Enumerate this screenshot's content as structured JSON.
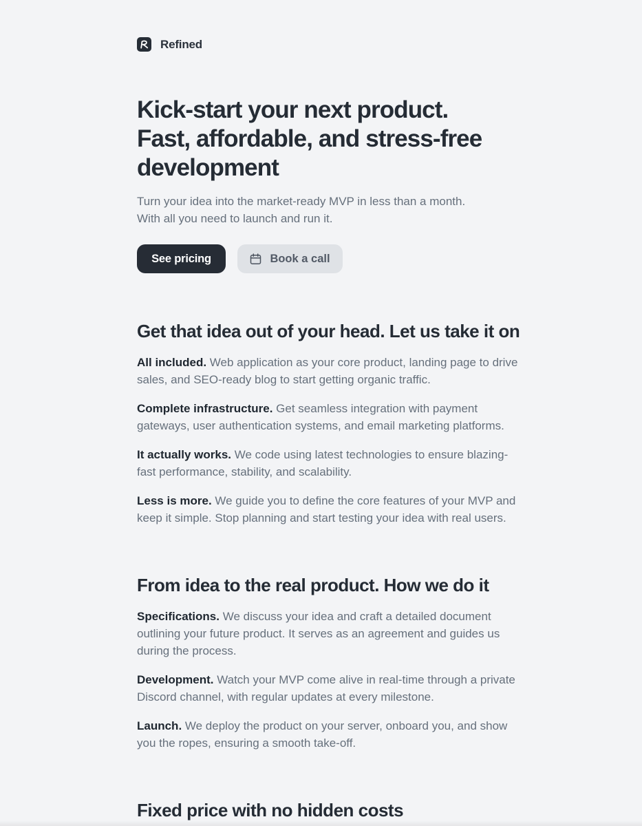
{
  "brand": {
    "name": "Refined",
    "logo_icon": "script-r-logo-icon"
  },
  "hero": {
    "title_lines": [
      "Kick-start your next product.",
      "Fast, affordable, and stress-free",
      "development"
    ],
    "subtitle_lines": [
      "Turn your idea into the market-ready MVP in less than a month.",
      "With all you need to launch and run it."
    ],
    "primary_button": "See pricing",
    "secondary_button": "Book a call",
    "secondary_button_icon": "calendar-icon"
  },
  "features": {
    "title": "Get that idea out of your head. Let us take it on",
    "items": [
      {
        "label": "All included.",
        "lines": [
          " Web application as your core product, landing page to drive",
          "sales, and SEO-ready blog to start getting organic traffic."
        ]
      },
      {
        "label": "Complete infrastructure.",
        "lines": [
          " Get seamless integration with payment",
          "gateways, user authentication systems, and email marketing platforms."
        ]
      },
      {
        "label": "It actually works.",
        "lines": [
          " We code using latest technologies to ensure blazing-",
          "fast performance, stability, and scalability."
        ]
      },
      {
        "label": "Less is more.",
        "lines": [
          " We guide you to define the core features of your MVP and",
          "keep it simple. Stop planning and start testing your idea with real users."
        ]
      }
    ]
  },
  "process": {
    "title": "From idea to the real product. How we do it",
    "items": [
      {
        "label": "Specifications.",
        "lines": [
          " We discuss your idea and craft a detailed document",
          "outlining your future product. It serves as an agreement and guides us",
          "during the process."
        ]
      },
      {
        "label": "Development.",
        "lines": [
          " Watch your MVP come alive in real-time through a private",
          "Discord channel, with regular updates at every milestone."
        ]
      },
      {
        "label": "Launch.",
        "lines": [
          " We deploy the product on your server, onboard you, and show",
          "you the ropes, ensuring a smooth take-off."
        ]
      }
    ]
  },
  "pricing": {
    "title": "Fixed price with no hidden costs"
  },
  "colors": {
    "background": "#f3f4f6",
    "heading": "#252c35",
    "body_text": "#66707c",
    "primary_button_bg": "#262c35",
    "secondary_button_bg": "#dfe2e6"
  }
}
